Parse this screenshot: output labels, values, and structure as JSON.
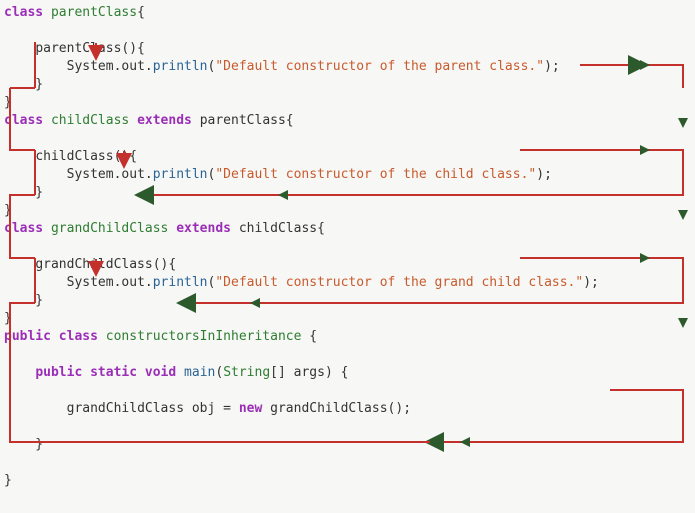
{
  "code": {
    "l1": {
      "kw": "class",
      "cls": "parentClass",
      "brace": "{"
    },
    "l2": "",
    "l3": {
      "ctor": "parentClass",
      "parens": "(){"
    },
    "l4": {
      "sout": "System.out.",
      "fn": "println",
      "open": "(",
      "str": "\"Default constructor of the parent class.\"",
      "close": ");"
    },
    "l5": "    }",
    "l6": "}",
    "l7": {
      "kw": "class",
      "cls": "childClass",
      "ext": "extends",
      "par": "parentClass",
      "brace": "{"
    },
    "l8": "",
    "l9": {
      "ctor": "childClass",
      "parens": "(){"
    },
    "l10": {
      "sout": "System.out.",
      "fn": "println",
      "open": "(",
      "str": "\"Default constructor of the child class.\"",
      "close": ");"
    },
    "l11": "    }",
    "l12": "}",
    "l13": {
      "kw": "class",
      "cls": "grandChildClass",
      "ext": "extends",
      "par": "childClass",
      "brace": "{"
    },
    "l14": "",
    "l15": {
      "ctor": "grandChildClass",
      "parens": "(){"
    },
    "l16": {
      "sout": "System.out.",
      "fn": "println",
      "open": "(",
      "str": "\"Default constructor of the grand child class.\"",
      "close": ");"
    },
    "l17": "    }",
    "l18": "}",
    "l19": {
      "pub": "public",
      "kw": "class",
      "cls": "constructorsInInheritance",
      "brace": " {"
    },
    "l20": "",
    "l21": {
      "pub": "public",
      "stat": "static",
      "vd": "void",
      "main": "main",
      "open": "(",
      "stype": "String",
      "arr": "[] args) {"
    },
    "l22": "",
    "l23": {
      "type": "grandChildClass",
      "var": " obj ",
      "eq": "=",
      "new": " new ",
      "ctor": "grandChildClass",
      "end": "();"
    },
    "l24": "",
    "l25": "    }",
    "l26": "",
    "l27": "}"
  }
}
